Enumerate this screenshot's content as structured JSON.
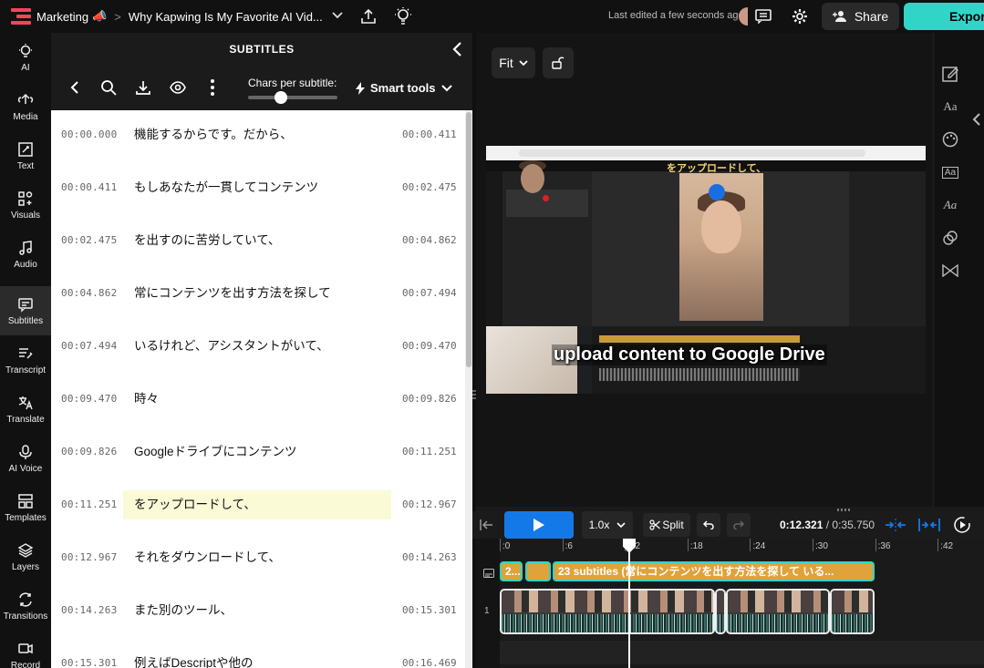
{
  "topbar": {
    "workspace": "Marketing",
    "workspace_emoji": "📣",
    "separator": ">",
    "project_title": "Why Kapwing Is My Favorite AI Vid...",
    "last_edited": "Last edited a few seconds ago",
    "share_label": "Share",
    "export_label": "Export"
  },
  "leftnav": {
    "items": [
      {
        "label": "AI",
        "icon": "lightbulb-icon"
      },
      {
        "label": "Media",
        "icon": "upload-icon"
      },
      {
        "label": "Text",
        "icon": "text-icon"
      },
      {
        "label": "Visuals",
        "icon": "visuals-icon"
      },
      {
        "label": "Audio",
        "icon": "music-note-icon"
      },
      {
        "label": "Subtitles",
        "icon": "subtitles-icon"
      },
      {
        "label": "Transcript",
        "icon": "transcript-icon"
      },
      {
        "label": "Translate",
        "icon": "translate-icon"
      },
      {
        "label": "AI Voice",
        "icon": "microphone-icon"
      },
      {
        "label": "Templates",
        "icon": "templates-icon"
      },
      {
        "label": "Layers",
        "icon": "layers-icon"
      },
      {
        "label": "Transitions",
        "icon": "transitions-icon"
      },
      {
        "label": "Record",
        "icon": "record-icon"
      }
    ],
    "active": "Subtitles"
  },
  "subtitles_panel": {
    "title": "SUBTITLES",
    "chars_per_subtitle_label": "Chars per subtitle:",
    "chars_slider_value": 0.3,
    "smart_tools_label": "Smart tools",
    "rows": [
      {
        "start": "00:00.000",
        "text": "機能するからです。だから、",
        "end": "00:00.411",
        "highlighted": false
      },
      {
        "start": "00:00.411",
        "text": "もしあなたが一貫してコンテンツ",
        "end": "00:02.475",
        "highlighted": false
      },
      {
        "start": "00:02.475",
        "text": "を出すのに苦労していて、",
        "end": "00:04.862",
        "highlighted": false
      },
      {
        "start": "00:04.862",
        "text": "常にコンテンツを出す方法を探して",
        "end": "00:07.494",
        "highlighted": false
      },
      {
        "start": "00:07.494",
        "text": "いるけれど、アシスタントがいて、",
        "end": "00:09.470",
        "highlighted": false
      },
      {
        "start": "00:09.470",
        "text": "時々",
        "end": "00:09.826",
        "highlighted": false
      },
      {
        "start": "00:09.826",
        "text": "Googleドライブにコンテンツ",
        "end": "00:11.251",
        "highlighted": false
      },
      {
        "start": "00:11.251",
        "text": "をアップロードして、",
        "end": "00:12.967",
        "highlighted": true
      },
      {
        "start": "00:12.967",
        "text": "それをダウンロードして、",
        "end": "00:14.263",
        "highlighted": false
      },
      {
        "start": "00:14.263",
        "text": "また別のツール、",
        "end": "00:15.301",
        "highlighted": false
      },
      {
        "start": "00:15.301",
        "text": "例えばDescriptや他の",
        "end": "00:16.469",
        "highlighted": false
      }
    ]
  },
  "stage": {
    "fit_label": "Fit",
    "video_top_subtitle": "をアップロードして、",
    "caption": "upload content to Google Drive"
  },
  "controls": {
    "speed": "1.0x",
    "split_label": "Split",
    "current_time": "0:12.321",
    "time_separator": " / ",
    "total_time": "0:35.750"
  },
  "timeline": {
    "ticks": [
      ":0",
      ":6",
      ":12",
      ":18",
      ":24",
      ":30",
      ":36",
      ":42"
    ],
    "subtitle_clips": [
      {
        "label": "2..."
      },
      {
        "label": ""
      },
      {
        "label": "23 subtitles (常にコンテンツを出す方法を探して いる..."
      }
    ],
    "video_track_number": "1",
    "playhead_time_seconds": 12.321
  },
  "colors": {
    "accent_teal": "#30d5c8",
    "play_blue": "#1479e8",
    "subtitle_clip": "#e0a23a",
    "highlight_row": "#fbfad6",
    "logo_red": "#f0465a"
  }
}
